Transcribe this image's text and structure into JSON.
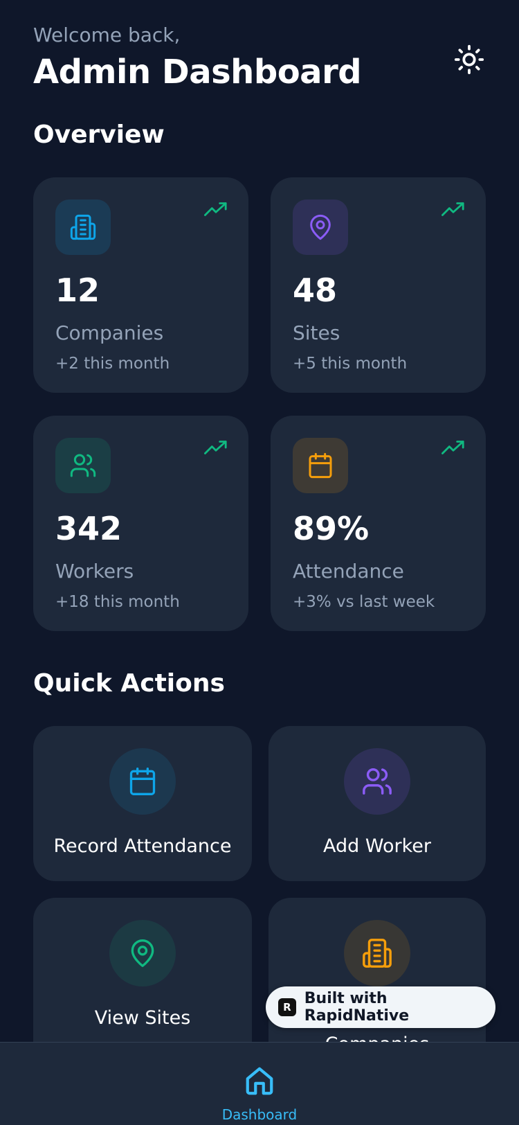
{
  "header": {
    "welcome": "Welcome back,",
    "title": "Admin Dashboard",
    "theme_toggle_icon": "sun-icon"
  },
  "overview": {
    "title": "Overview",
    "cards": [
      {
        "icon": "building-icon",
        "value": "12",
        "label": "Companies",
        "change": "+2 this month",
        "color": "#0ea5e9"
      },
      {
        "icon": "map-pin-icon",
        "value": "48",
        "label": "Sites",
        "change": "+5 this month",
        "color": "#8b5cf6"
      },
      {
        "icon": "users-icon",
        "value": "342",
        "label": "Workers",
        "change": "+18 this month",
        "color": "#10b981"
      },
      {
        "icon": "calendar-icon",
        "value": "89%",
        "label": "Attendance",
        "change": "+3% vs last week",
        "color": "#f59e0b"
      }
    ],
    "trend_icon": "trending-up-icon",
    "trend_color": "#10b981"
  },
  "quick_actions": {
    "title": "Quick Actions",
    "items": [
      {
        "icon": "calendar-icon",
        "label": "Record Attendance",
        "color": "#0ea5e9"
      },
      {
        "icon": "users-icon",
        "label": "Add Worker",
        "color": "#8b5cf6"
      },
      {
        "icon": "map-pin-icon",
        "label": "View Sites",
        "color": "#10b981"
      },
      {
        "icon": "building-icon",
        "label": "Companies",
        "color": "#f59e0b"
      }
    ]
  },
  "badge": {
    "logo": "R",
    "text": "Built with RapidNative"
  },
  "tabbar": {
    "items": [
      {
        "icon": "home-icon",
        "label": "Dashboard",
        "active": true,
        "color": "#38bdf8"
      }
    ]
  }
}
